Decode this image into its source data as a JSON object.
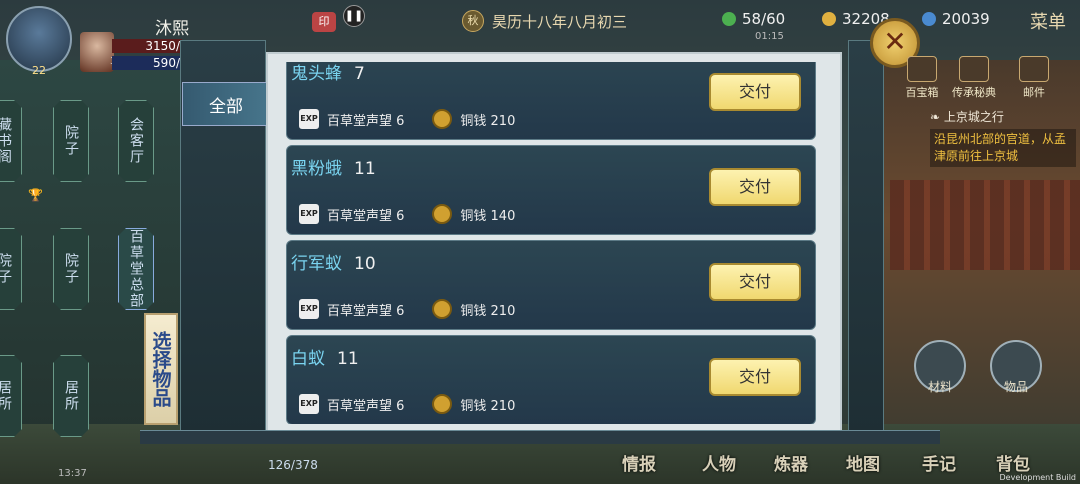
{
  "top": {
    "avatar_level": "22",
    "companion_level": "30",
    "player_name": "沐熙",
    "hp": "3150/",
    "mp": "590/",
    "date": "昊历十八年八月初三",
    "date_emblem": "秋",
    "stamina": "58/60",
    "stamina_timer": "01:15",
    "coins": "32208",
    "gems": "20039",
    "menu": "菜单"
  },
  "map_nodes": [
    "藏书阁",
    "院子",
    "会客厅",
    "院子",
    "院子",
    "百草堂总部",
    "居所",
    "居所"
  ],
  "panel": {
    "tab_all": "全部",
    "select_banner": "选择物品",
    "close": "✕",
    "items": [
      {
        "name": "鬼头蜂",
        "count": "7",
        "reputation": "百草堂声望 6",
        "copper": "铜钱 210",
        "button": "交付"
      },
      {
        "name": "黑粉蛾",
        "count": "11",
        "reputation": "百草堂声望 6",
        "copper": "铜钱 140",
        "button": "交付"
      },
      {
        "name": "行军蚁",
        "count": "10",
        "reputation": "百草堂声望 6",
        "copper": "铜钱 210",
        "button": "交付"
      },
      {
        "name": "白蚁",
        "count": "11",
        "reputation": "百草堂声望 6",
        "copper": "铜钱 210",
        "button": "交付"
      }
    ]
  },
  "right": {
    "icons": [
      "百宝箱",
      "传承秘典",
      "邮件"
    ],
    "quest_title": "上京城之行",
    "quest_desc": "沿昆州北部的官道，从孟津原前往上京城",
    "materials": "材料",
    "items": "物品"
  },
  "bottom": {
    "bag": "126/378",
    "clock": "13:37",
    "nav": [
      "情报",
      "人物",
      "炼器",
      "地图",
      "手记",
      "背包"
    ],
    "dev": "Development Build"
  }
}
